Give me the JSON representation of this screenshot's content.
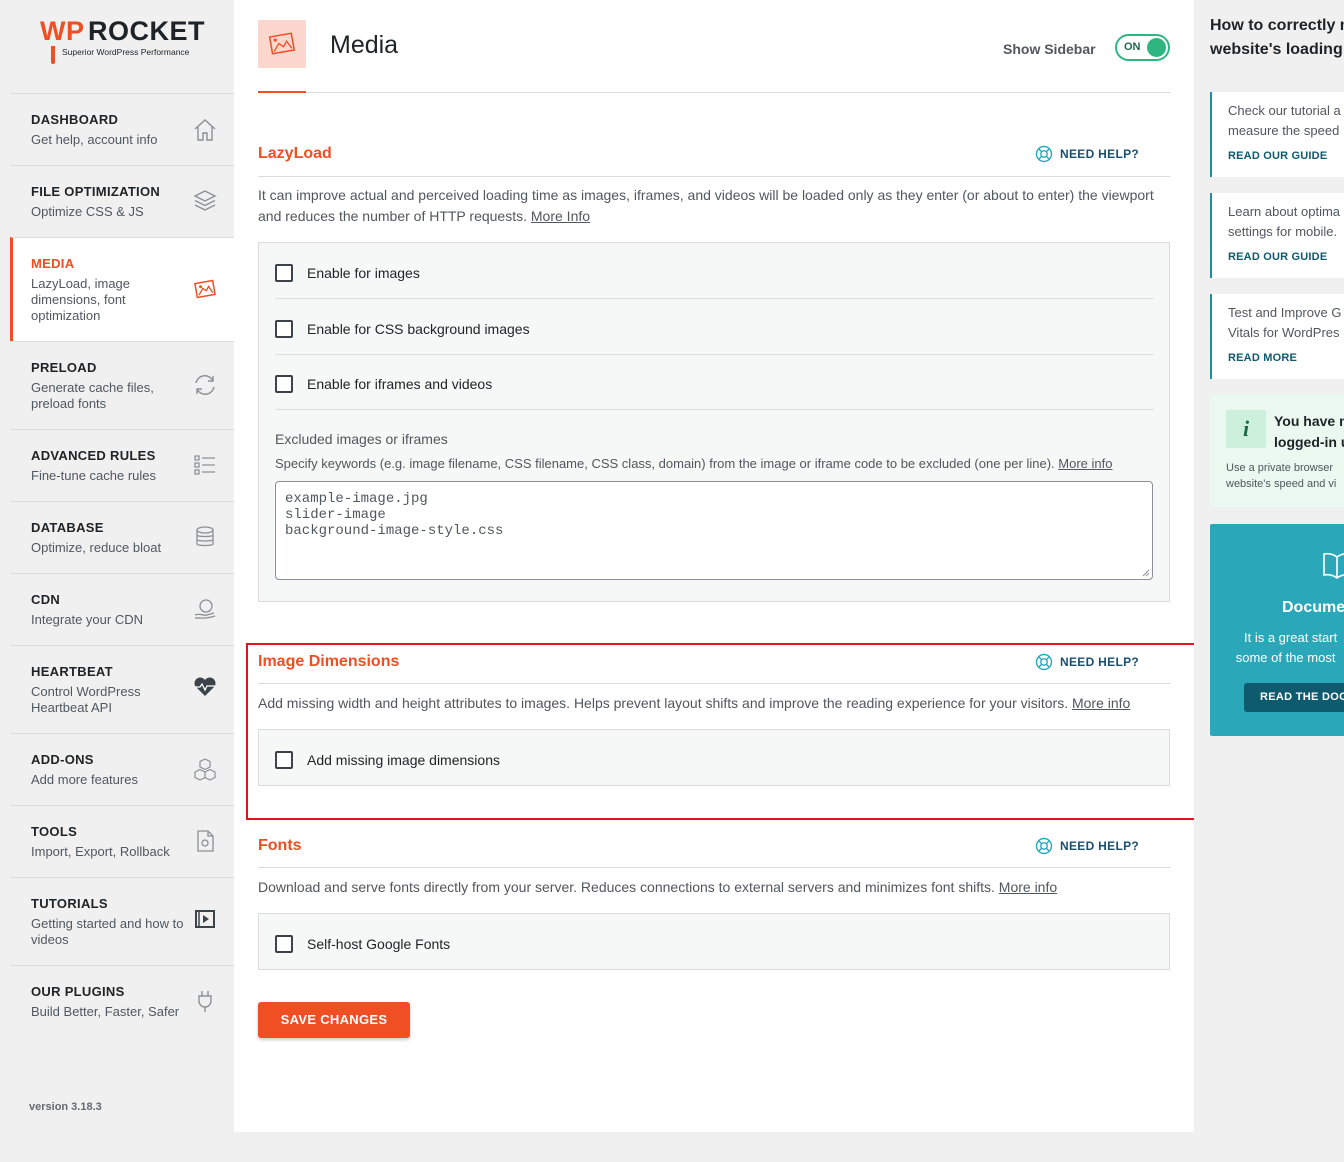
{
  "logo": {
    "brand_wp": "WP",
    "brand_rocket": "ROCKET",
    "tagline": "Superior WordPress Performance"
  },
  "nav": [
    {
      "title": "DASHBOARD",
      "subtitle": "Get help, account info",
      "icon": "home-icon"
    },
    {
      "title": "FILE OPTIMIZATION",
      "subtitle": "Optimize CSS & JS",
      "icon": "layers-icon"
    },
    {
      "title": "MEDIA",
      "subtitle": "LazyLoad, image dimensions, font optimization",
      "icon": "image-icon",
      "active": true
    },
    {
      "title": "PRELOAD",
      "subtitle": "Generate cache files, preload fonts",
      "icon": "refresh-icon"
    },
    {
      "title": "ADVANCED RULES",
      "subtitle": "Fine-tune cache rules",
      "icon": "list-icon"
    },
    {
      "title": "DATABASE",
      "subtitle": "Optimize, reduce bloat",
      "icon": "database-icon"
    },
    {
      "title": "CDN",
      "subtitle": "Integrate your CDN",
      "icon": "globe-hand-icon"
    },
    {
      "title": "HEARTBEAT",
      "subtitle": "Control WordPress Heartbeat API",
      "icon": "heartbeat-icon"
    },
    {
      "title": "ADD-ONS",
      "subtitle": "Add more features",
      "icon": "cubes-icon"
    },
    {
      "title": "TOOLS",
      "subtitle": "Import, Export, Rollback",
      "icon": "file-gear-icon"
    },
    {
      "title": "TUTORIALS",
      "subtitle": "Getting started and how to videos",
      "icon": "video-icon"
    },
    {
      "title": "OUR PLUGINS",
      "subtitle": "Build Better, Faster, Safer",
      "icon": "plug-icon"
    }
  ],
  "version": "version 3.18.3",
  "header": {
    "title": "Media",
    "show_sidebar_label": "Show Sidebar",
    "toggle_label": "ON",
    "toggle_on": true
  },
  "need_help_label": "NEED HELP?",
  "lazyload": {
    "title": "LazyLoad",
    "description": "It can improve actual and perceived loading time as images, iframes, and videos will be loaded only as they enter (or about to enter) the viewport and reduces the number of HTTP requests.",
    "more_link": "More Info",
    "options": [
      {
        "label": "Enable for images",
        "checked": false
      },
      {
        "label": "Enable for CSS background images",
        "checked": false
      },
      {
        "label": "Enable for iframes and videos",
        "checked": false
      }
    ],
    "excluded_label": "Excluded images or iframes",
    "excluded_desc": "Specify keywords (e.g. image filename, CSS filename, CSS class, domain) from the image or iframe code to be excluded (one per line).",
    "excluded_more": "More info",
    "excluded_values": [
      "example-image.jpg",
      "slider-image",
      "background-image-style.css"
    ]
  },
  "image_dimensions": {
    "title": "Image Dimensions",
    "description": "Add missing width and height attributes to images. Helps prevent layout shifts and improve the reading experience for your visitors.",
    "more_link": "More info",
    "option": "Add missing image dimensions"
  },
  "fonts": {
    "title": "Fonts",
    "description": "Download and serve fonts directly from your server. Reduces connections to external servers and minimizes font shifts.",
    "more_link": "More info",
    "option": "Self-host Google Fonts"
  },
  "save_label": "SAVE CHANGES",
  "right_sidebar": {
    "title_line1": "How to correctly m",
    "title_line2": "website's loading t",
    "cards": [
      {
        "line1": "Check our tutorial a",
        "line2": "measure the speed",
        "cta": "READ OUR GUIDE"
      },
      {
        "line1": "Learn about optima",
        "line2": "settings for mobile.",
        "cta": "READ OUR GUIDE"
      },
      {
        "line1": "Test and Improve G",
        "line2": "Vitals for WordPres",
        "cta": "READ MORE"
      }
    ],
    "info": {
      "icon_text": "i",
      "line1": "You have n",
      "line2": "logged-in u",
      "desc1": "Use a private browser",
      "desc2": "website's speed and vi"
    },
    "doc": {
      "title": "Docume",
      "line1": "It is a great start",
      "line2": "some of the most",
      "button": "READ THE DOC"
    }
  },
  "colors": {
    "accent": "#f04e23",
    "teal": "#2aa8b9",
    "toggle_green": "#2fb680",
    "highlight": "#e0141d"
  }
}
